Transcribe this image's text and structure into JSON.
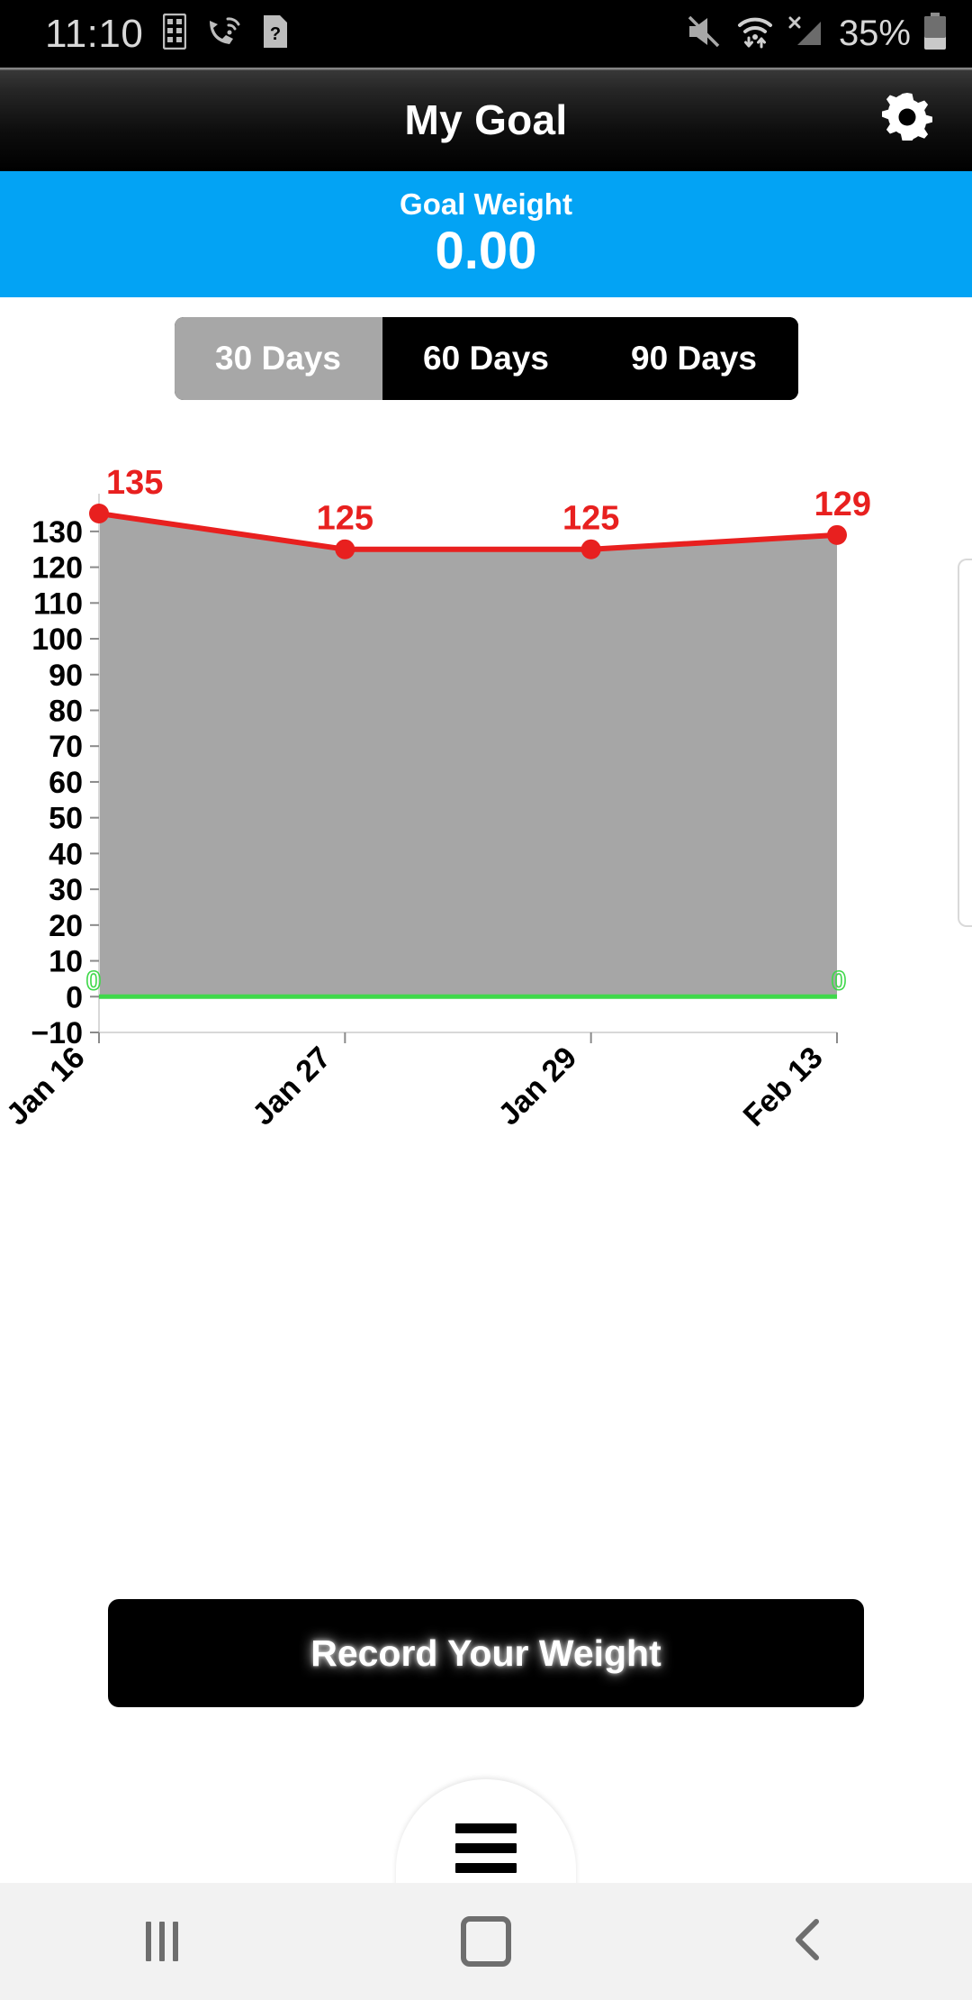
{
  "status_bar": {
    "time": "11:10",
    "battery_percent": "35%",
    "left_icons": [
      "keypad-icon",
      "wifi-calling-icon",
      "sim-card-question-icon"
    ],
    "right_icons": [
      "mute-icon",
      "wifi-data-icon",
      "no-signal-icon",
      "battery-icon"
    ]
  },
  "app_bar": {
    "title": "My Goal",
    "settings_icon": "gear-icon"
  },
  "goal_banner": {
    "label": "Goal Weight",
    "value": "0.00",
    "background_color": "#03a3f4"
  },
  "range_tabs": {
    "items": [
      {
        "label": "30 Days",
        "selected": true
      },
      {
        "label": "60 Days",
        "selected": false
      },
      {
        "label": "90 Days",
        "selected": false
      }
    ],
    "selected_color": "#a7a7a7",
    "unselected_color": "#000000"
  },
  "chart_data": {
    "type": "line",
    "title": "",
    "xlabel": "",
    "ylabel": "",
    "categories": [
      "Jan 16",
      "Jan 27",
      "Jan 29",
      "Feb 13"
    ],
    "series": [
      {
        "name": "Weight",
        "values": [
          135,
          125,
          125,
          129
        ],
        "color": "#e8201f"
      },
      {
        "name": "Goal Weight",
        "values": [
          0,
          0,
          0,
          0
        ],
        "color": "#3fd84a"
      }
    ],
    "point_labels": [
      "135",
      "125",
      "125",
      "129"
    ],
    "goal_point_labels": [
      "0",
      "0"
    ],
    "ylim": [
      -10,
      135
    ],
    "yticks": [
      130,
      120,
      110,
      100,
      90,
      80,
      70,
      60,
      50,
      40,
      30,
      20,
      10,
      0,
      -10
    ],
    "ytick_labels": [
      "130",
      "120",
      "110",
      "100",
      "90",
      "80",
      "70",
      "60",
      "50",
      "40",
      "30",
      "20",
      "10",
      "0",
      "−10"
    ],
    "grid": false,
    "legend": "none",
    "fill_color": "#a6a6a6",
    "axis_color": "#d8d8d8"
  },
  "record_button": {
    "label": "Record Your Weight"
  },
  "fab": {
    "icon": "hamburger-menu-icon"
  },
  "nav_bar": {
    "recents_icon": "recents-icon",
    "home_icon": "home-icon",
    "back_icon": "back-icon"
  }
}
